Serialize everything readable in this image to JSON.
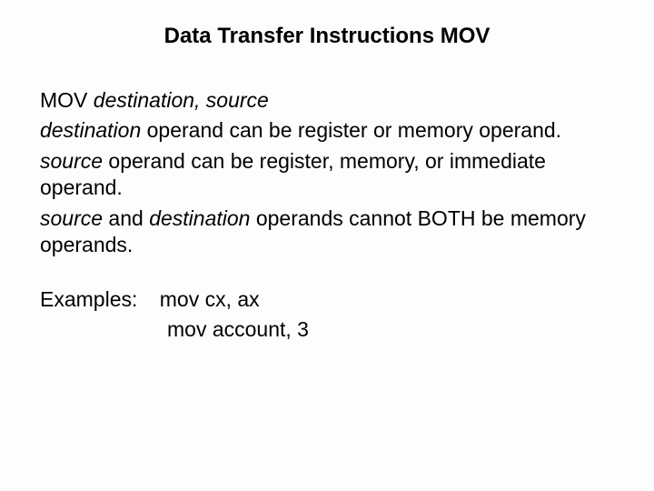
{
  "title": "Data Transfer Instructions MOV",
  "syntax": {
    "mnemonic": "MOV ",
    "operands": "destination, source"
  },
  "rules": {
    "dest_it": "destination",
    "dest_rest": " operand can be register or memory operand.",
    "src_it": "source",
    "src_rest": " operand can be register, memory, or immediate operand.",
    "both_src": "source",
    "both_mid": " and ",
    "both_dest": "destination",
    "both_rest": " operands cannot BOTH be memory operands."
  },
  "examples": {
    "label": "Examples:",
    "line1": "mov cx, ax",
    "line2": "mov account, 3"
  }
}
